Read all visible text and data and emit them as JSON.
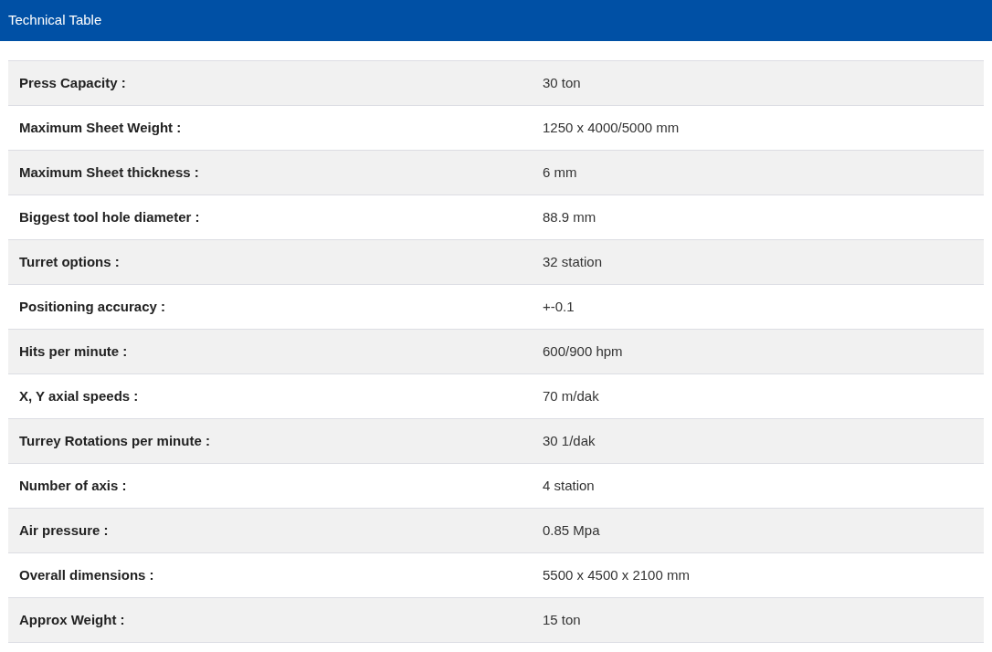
{
  "header": {
    "title": "Technical Table"
  },
  "table": {
    "rows": [
      {
        "label": "Press Capacity :",
        "value": "30 ton"
      },
      {
        "label": "Maximum Sheet Weight :",
        "value": "1250 x 4000/5000 mm"
      },
      {
        "label": "Maximum Sheet thickness :",
        "value": "6 mm"
      },
      {
        "label": "Biggest tool hole diameter :",
        "value": "88.9 mm"
      },
      {
        "label": "Turret options :",
        "value": "32 station"
      },
      {
        "label": "Positioning accuracy :",
        "value": "+-0.1"
      },
      {
        "label": "Hits per minute :",
        "value": "600/900 hpm"
      },
      {
        "label": "X, Y axial speeds :",
        "value": "70 m/dak"
      },
      {
        "label": "Turrey Rotations per minute :",
        "value": "30 1/dak"
      },
      {
        "label": "Number of axis :",
        "value": "4 station"
      },
      {
        "label": "Air pressure :",
        "value": "0.85 Mpa"
      },
      {
        "label": "Overall dimensions :",
        "value": "5500 x 4500 x 2100 mm"
      },
      {
        "label": "Approx Weight :",
        "value": "15 ton"
      }
    ]
  }
}
